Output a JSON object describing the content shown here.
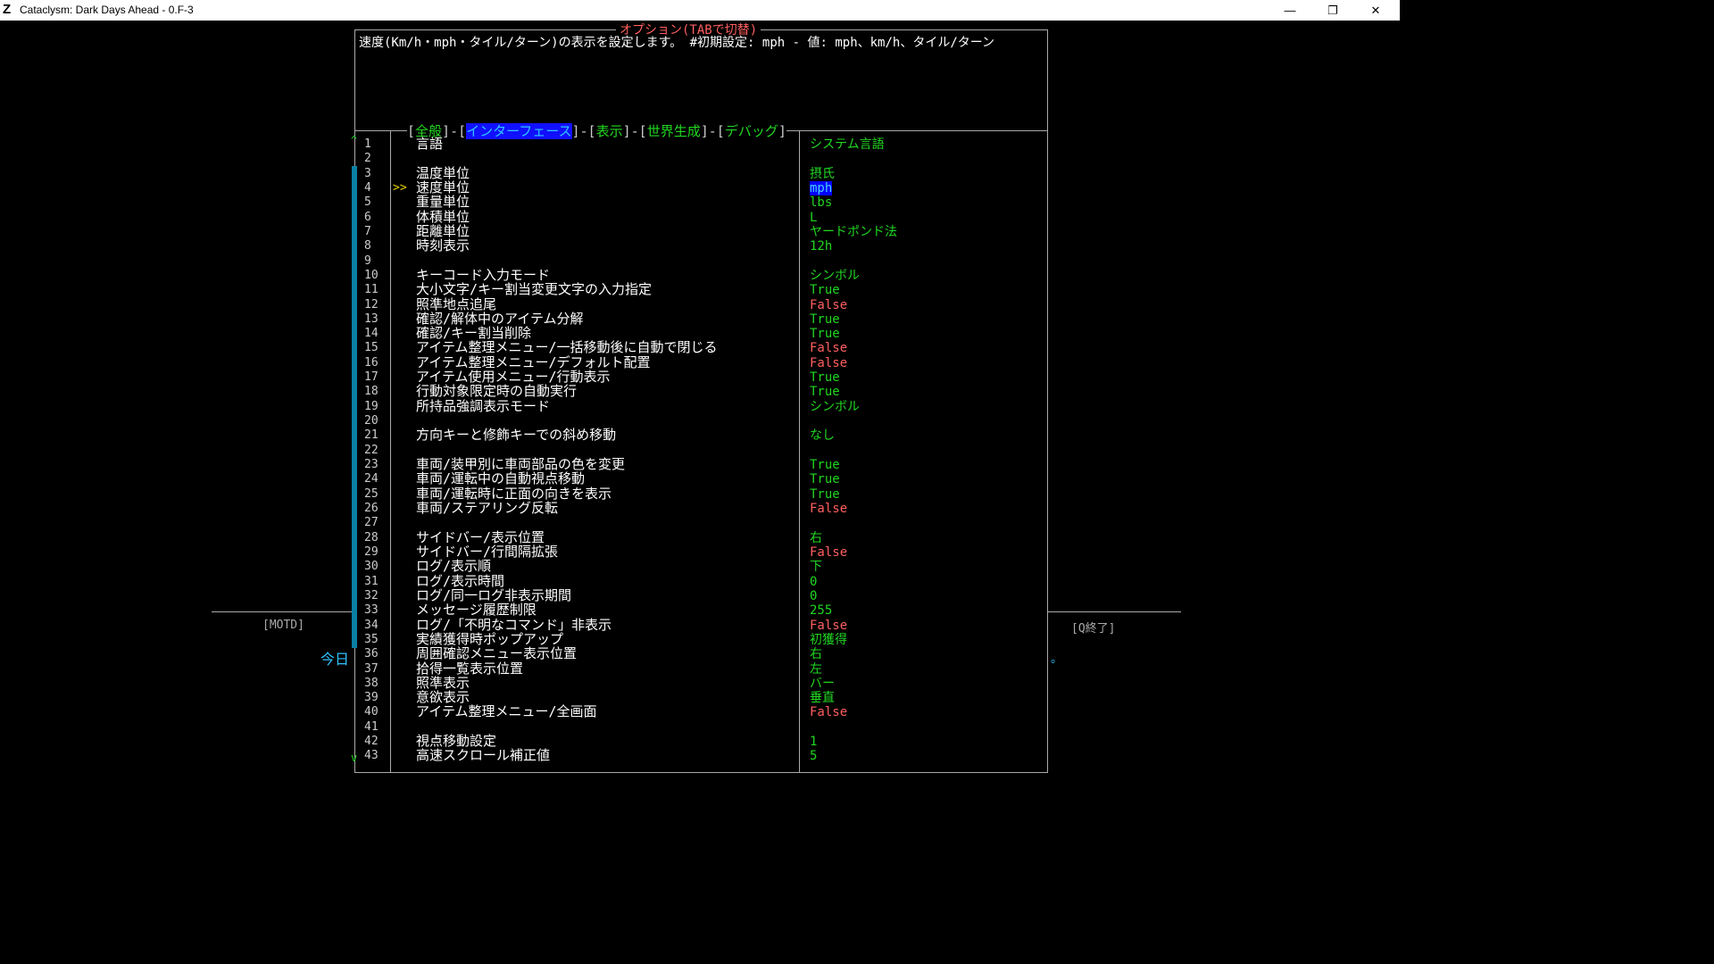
{
  "window": {
    "title": "Cataclysm: Dark Days Ahead - 0.F-3",
    "icon": "Z",
    "minimize": "—",
    "restore": "❐",
    "close": "✕"
  },
  "options": {
    "heading": "オプション(TABで切替)",
    "description": "速度(Km/h・mph・タイル/ターン)の表示を設定します。 #初期設定: mph - 値: mph、km/h、タイル/ターン",
    "tabs": [
      {
        "label": "全般",
        "active": false
      },
      {
        "label": "インターフェース",
        "active": true
      },
      {
        "label": "表示",
        "active": false
      },
      {
        "label": "世界生成",
        "active": false
      },
      {
        "label": "デバッグ",
        "active": false
      }
    ],
    "cursor": ">>",
    "scroll_up": "^",
    "scroll_down": "v",
    "rows": [
      {
        "n": "1",
        "label": "言語",
        "value": "システム言語",
        "cls": "green"
      },
      {
        "n": "2",
        "label": "",
        "value": "",
        "cls": ""
      },
      {
        "n": "3",
        "label": "温度単位",
        "value": "摂氏",
        "cls": "green"
      },
      {
        "n": "4",
        "label": "速度単位",
        "value": "mph",
        "cls": "sel-val",
        "selected": true
      },
      {
        "n": "5",
        "label": "重量単位",
        "value": "lbs",
        "cls": "green"
      },
      {
        "n": "6",
        "label": "体積単位",
        "value": "L",
        "cls": "green"
      },
      {
        "n": "7",
        "label": "距離単位",
        "value": "ヤードポンド法",
        "cls": "green"
      },
      {
        "n": "8",
        "label": "時刻表示",
        "value": "12h",
        "cls": "green"
      },
      {
        "n": "9",
        "label": "",
        "value": "",
        "cls": ""
      },
      {
        "n": "10",
        "label": "キーコード入力モード",
        "value": "シンボル",
        "cls": "green"
      },
      {
        "n": "11",
        "label": "大小文字/キー割当変更文字の入力指定",
        "value": "True",
        "cls": "true"
      },
      {
        "n": "12",
        "label": "照準地点追尾",
        "value": "False",
        "cls": "false"
      },
      {
        "n": "13",
        "label": "確認/解体中のアイテム分解",
        "value": "True",
        "cls": "true"
      },
      {
        "n": "14",
        "label": "確認/キー割当削除",
        "value": "True",
        "cls": "true"
      },
      {
        "n": "15",
        "label": "アイテム整理メニュー/一括移動後に自動で閉じる",
        "value": "False",
        "cls": "false"
      },
      {
        "n": "16",
        "label": "アイテム整理メニュー/デフォルト配置",
        "value": "False",
        "cls": "false"
      },
      {
        "n": "17",
        "label": "アイテム使用メニュー/行動表示",
        "value": "True",
        "cls": "true"
      },
      {
        "n": "18",
        "label": "行動対象限定時の自動実行",
        "value": "True",
        "cls": "true"
      },
      {
        "n": "19",
        "label": "所持品強調表示モード",
        "value": "シンボル",
        "cls": "green"
      },
      {
        "n": "20",
        "label": "",
        "value": "",
        "cls": ""
      },
      {
        "n": "21",
        "label": "方向キーと修飾キーでの斜め移動",
        "value": "なし",
        "cls": "green"
      },
      {
        "n": "22",
        "label": "",
        "value": "",
        "cls": ""
      },
      {
        "n": "23",
        "label": "車両/装甲別に車両部品の色を変更",
        "value": "True",
        "cls": "true"
      },
      {
        "n": "24",
        "label": "車両/運転中の自動視点移動",
        "value": "True",
        "cls": "true"
      },
      {
        "n": "25",
        "label": "車両/運転時に正面の向きを表示",
        "value": "True",
        "cls": "true"
      },
      {
        "n": "26",
        "label": "車両/ステアリング反転",
        "value": "False",
        "cls": "false"
      },
      {
        "n": "27",
        "label": "",
        "value": "",
        "cls": ""
      },
      {
        "n": "28",
        "label": "サイドバー/表示位置",
        "value": "右",
        "cls": "green"
      },
      {
        "n": "29",
        "label": "サイドバー/行間隔拡張",
        "value": "False",
        "cls": "false"
      },
      {
        "n": "30",
        "label": "ログ/表示順",
        "value": "下",
        "cls": "green"
      },
      {
        "n": "31",
        "label": "ログ/表示時間",
        "value": "0",
        "cls": "green"
      },
      {
        "n": "32",
        "label": "ログ/同一ログ非表示期間",
        "value": "0",
        "cls": "green"
      },
      {
        "n": "33",
        "label": "メッセージ履歴制限",
        "value": "255",
        "cls": "green"
      },
      {
        "n": "34",
        "label": "ログ/「不明なコマンド」非表示",
        "value": "False",
        "cls": "false"
      },
      {
        "n": "35",
        "label": "実績獲得時ポップアップ",
        "value": "初獲得",
        "cls": "green"
      },
      {
        "n": "36",
        "label": "周囲確認メニュー表示位置",
        "value": "右",
        "cls": "green"
      },
      {
        "n": "37",
        "label": "拾得一覧表示位置",
        "value": "左",
        "cls": "green"
      },
      {
        "n": "38",
        "label": "照準表示",
        "value": "バー",
        "cls": "green"
      },
      {
        "n": "39",
        "label": "意欲表示",
        "value": "垂直",
        "cls": "green"
      },
      {
        "n": "40",
        "label": "アイテム整理メニュー/全画面",
        "value": "False",
        "cls": "false"
      },
      {
        "n": "41",
        "label": "",
        "value": "",
        "cls": ""
      },
      {
        "n": "42",
        "label": "視点移動設定",
        "value": "1",
        "cls": "green"
      },
      {
        "n": "43",
        "label": "高速スクロール補正値",
        "value": "5",
        "cls": "green"
      }
    ]
  },
  "background": {
    "motd": "[MOTD]",
    "quit": "[Q終了]",
    "today": "今日",
    "dot": "。"
  }
}
